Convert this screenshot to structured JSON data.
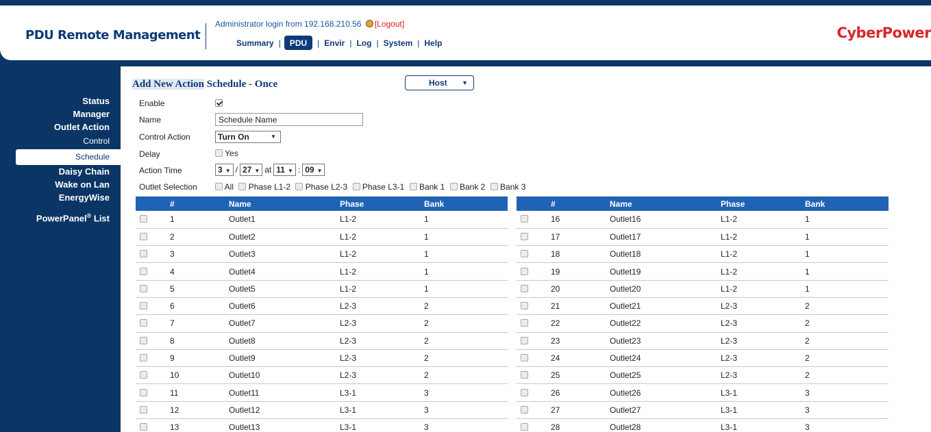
{
  "header": {
    "app_title": "PDU Remote Management",
    "login_text": "Administrator login from 192.168.210.56",
    "logout_label": "[Logout]",
    "brand": "CyberPower",
    "nav": [
      "Summary",
      "PDU",
      "Envir",
      "Log",
      "System",
      "Help"
    ],
    "active_nav": "PDU"
  },
  "sidebar": {
    "items": [
      {
        "label": "Status"
      },
      {
        "label": "Manager"
      },
      {
        "label": "Outlet Action"
      },
      {
        "label": "Control"
      },
      {
        "label": "Schedule"
      },
      {
        "label": "Daisy Chain"
      },
      {
        "label": "Wake on Lan"
      },
      {
        "label": "EnergyWise"
      },
      {
        "label": "PowerPanel",
        "sup": "®",
        "suffix": " List"
      }
    ],
    "selected": "Schedule"
  },
  "form": {
    "title_highlight": "Add New Action",
    "title_rest": " Schedule - Once",
    "host_select": "Host",
    "enable_label": "Enable",
    "enable_checked": true,
    "name_label": "Name",
    "name_value": "Schedule Name",
    "control_action_label": "Control Action",
    "control_action_value": "Turn On",
    "delay_label": "Delay",
    "delay_option": "Yes",
    "action_time_label": "Action Time",
    "month": "3",
    "day": "27",
    "at_text": "at",
    "hour": "11",
    "minute": "09",
    "outlet_selection_label": "Outlet Selection",
    "outlet_options": [
      "All",
      "Phase L1-2",
      "Phase L2-3",
      "Phase L3-1",
      "Bank 1",
      "Bank 2",
      "Bank 3"
    ]
  },
  "table": {
    "headers": [
      "#",
      "Name",
      "Phase",
      "Bank"
    ],
    "left_rows": [
      [
        "1",
        "Outlet1",
        "L1-2",
        "1"
      ],
      [
        "2",
        "Outlet2",
        "L1-2",
        "1"
      ],
      [
        "3",
        "Outlet3",
        "L1-2",
        "1"
      ],
      [
        "4",
        "Outlet4",
        "L1-2",
        "1"
      ],
      [
        "5",
        "Outlet5",
        "L1-2",
        "1"
      ],
      [
        "6",
        "Outlet6",
        "L2-3",
        "2"
      ],
      [
        "7",
        "Outlet7",
        "L2-3",
        "2"
      ],
      [
        "8",
        "Outlet8",
        "L2-3",
        "2"
      ],
      [
        "9",
        "Outlet9",
        "L2-3",
        "2"
      ],
      [
        "10",
        "Outlet10",
        "L2-3",
        "2"
      ],
      [
        "11",
        "Outlet11",
        "L3-1",
        "3"
      ],
      [
        "12",
        "Outlet12",
        "L3-1",
        "3"
      ],
      [
        "13",
        "Outlet13",
        "L3-1",
        "3"
      ]
    ],
    "right_rows": [
      [
        "16",
        "Outlet16",
        "L1-2",
        "1"
      ],
      [
        "17",
        "Outlet17",
        "L1-2",
        "1"
      ],
      [
        "18",
        "Outlet18",
        "L1-2",
        "1"
      ],
      [
        "19",
        "Outlet19",
        "L1-2",
        "1"
      ],
      [
        "20",
        "Outlet20",
        "L1-2",
        "1"
      ],
      [
        "21",
        "Outlet21",
        "L2-3",
        "2"
      ],
      [
        "22",
        "Outlet22",
        "L2-3",
        "2"
      ],
      [
        "23",
        "Outlet23",
        "L2-3",
        "2"
      ],
      [
        "24",
        "Outlet24",
        "L2-3",
        "2"
      ],
      [
        "25",
        "Outlet25",
        "L2-3",
        "2"
      ],
      [
        "26",
        "Outlet26",
        "L3-1",
        "3"
      ],
      [
        "27",
        "Outlet27",
        "L3-1",
        "3"
      ],
      [
        "28",
        "Outlet28",
        "L3-1",
        "3"
      ]
    ]
  },
  "colors": {
    "navy": "#0b3565",
    "table_header": "#1f63b4",
    "brand_red": "#d8262e",
    "logout_red": "#d62020"
  }
}
